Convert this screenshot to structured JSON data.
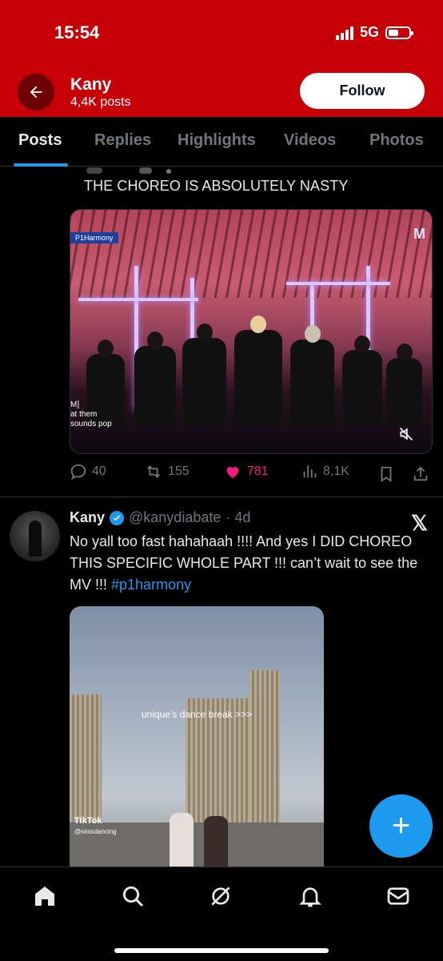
{
  "status_bar": {
    "time": "15:54",
    "network": "5G"
  },
  "header": {
    "title": "Kany",
    "subtitle": "4,4K posts",
    "follow_label": "Follow",
    "back_icon": "arrow-left-icon"
  },
  "tabs": [
    "Posts",
    "Replies",
    "Highlights",
    "Videos",
    "Photos"
  ],
  "active_tab": "Posts",
  "post1": {
    "quote_text": "THE CHOREO IS ABSOLUTELY NASTY",
    "media": {
      "channel_tag": "P1Harmony",
      "brand": "M",
      "caption_lines": [
        "M]",
        "at them",
        "sounds pop"
      ]
    },
    "actions": {
      "replies": "40",
      "reposts": "155",
      "likes": "781",
      "views": "8,1K"
    },
    "colors": {
      "like": "#f91880",
      "muted": "#71767b"
    }
  },
  "post2": {
    "name": "Kany",
    "handle": "@kanydiabate",
    "time": "· 4d",
    "text": "No yall too fast hahahaah !!!! And yes I DID CHOREO THIS SPECIFIC WHOLE PART !!! can’t wait to see the MV !!! ",
    "hashtag": "#p1harmony",
    "media": {
      "overlay_caption": "unique’s dance break >>>",
      "tiktok_label": "TikTok",
      "tiktok_user": "@ninisdancing"
    }
  },
  "fab": {
    "label": "+",
    "icon": "plus-icon"
  },
  "bottom_nav": [
    "home-icon",
    "search-icon",
    "grok-icon",
    "notifications-icon",
    "messages-icon"
  ],
  "colors": {
    "header_bg": "#c60006",
    "accent": "#1d9bf0",
    "bg": "#000000"
  }
}
